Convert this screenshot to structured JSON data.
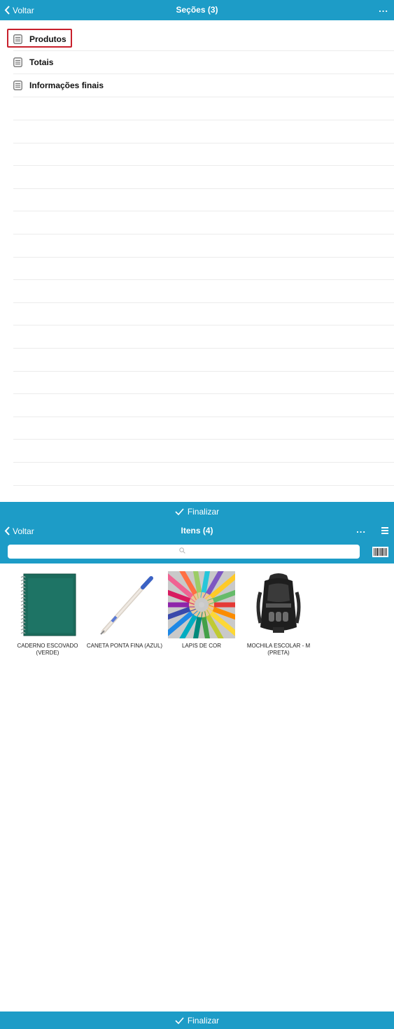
{
  "sections_screen": {
    "back_label": "Voltar",
    "title": "Seções (3)",
    "more_label": "...",
    "items": [
      {
        "label": "Produtos",
        "selected": true
      },
      {
        "label": "Totais",
        "selected": false
      },
      {
        "label": "Informações finais",
        "selected": false
      }
    ],
    "finish_label": "Finalizar"
  },
  "items_screen": {
    "back_label": "Voltar",
    "title": "Itens (4)",
    "more_label": "...",
    "search": {
      "placeholder": "",
      "value": ""
    },
    "products": [
      {
        "name": "CADERNO ESCOVADO (VERDE)",
        "icon": "notebook-image"
      },
      {
        "name": "CANETA PONTA FINA (AZUL)",
        "icon": "pen-image"
      },
      {
        "name": "LAPIS DE COR",
        "icon": "colored-pencils-image"
      },
      {
        "name": "MOCHILA ESCOLAR - M (PRETA)",
        "icon": "backpack-image"
      }
    ],
    "finish_label": "Finalizar"
  },
  "colors": {
    "accent": "#1d9cc7",
    "selection_border": "#c8202c",
    "divider": "#ececec"
  }
}
